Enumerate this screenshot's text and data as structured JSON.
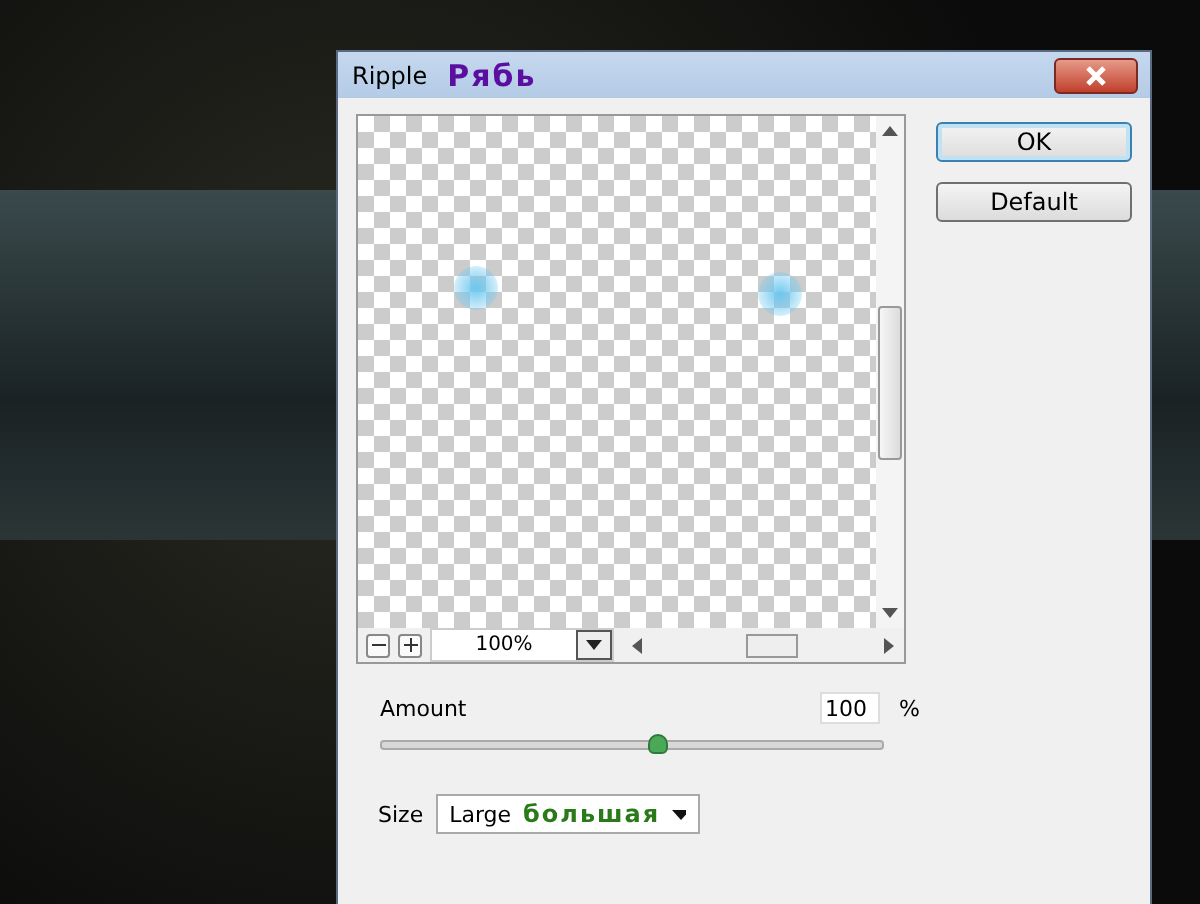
{
  "window": {
    "title": "Ripple",
    "title_note": "Рябь"
  },
  "preview": {
    "zoom": "100%"
  },
  "buttons": [
    {
      "label": "OK",
      "default": true
    },
    {
      "label": "Default",
      "default": false
    }
  ],
  "amount": {
    "label": "Amount",
    "value": "100",
    "unit": "%",
    "level": 0.55
  },
  "size": {
    "label": "Size",
    "value": "Large",
    "value_note": "большая"
  }
}
